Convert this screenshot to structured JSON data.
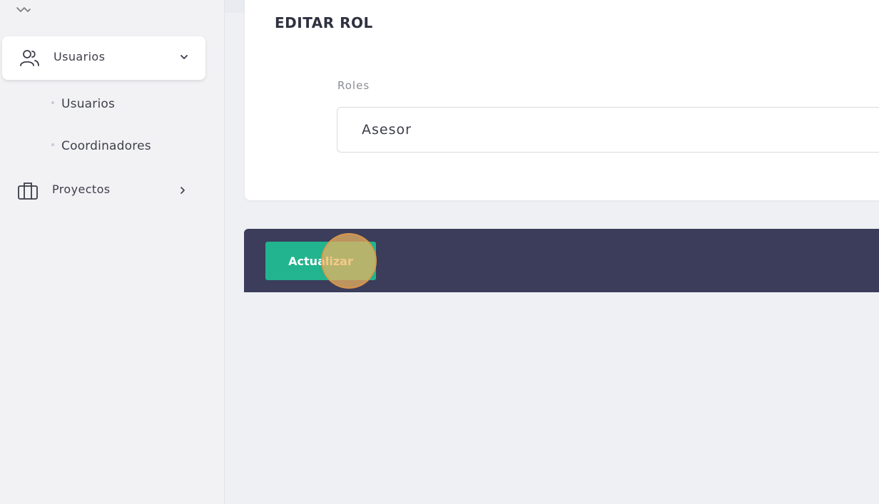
{
  "sidebar": {
    "active_item": {
      "label": "Usuarios",
      "icon": "users-icon",
      "expanded": true
    },
    "sub_items": [
      {
        "label": "Usuarios"
      },
      {
        "label": "Coordinadores"
      }
    ],
    "projects_item": {
      "label": "Proyectos",
      "icon": "briefcase-icon"
    }
  },
  "form": {
    "title": "EDITAR ROL",
    "roles_label": "Roles",
    "roles_value": "Asesor"
  },
  "actions": {
    "update_label": "Actualizar"
  },
  "colors": {
    "accent": "#21b48e",
    "action_bar": "#3b3d5b",
    "click_marker": "#f0b45f"
  }
}
